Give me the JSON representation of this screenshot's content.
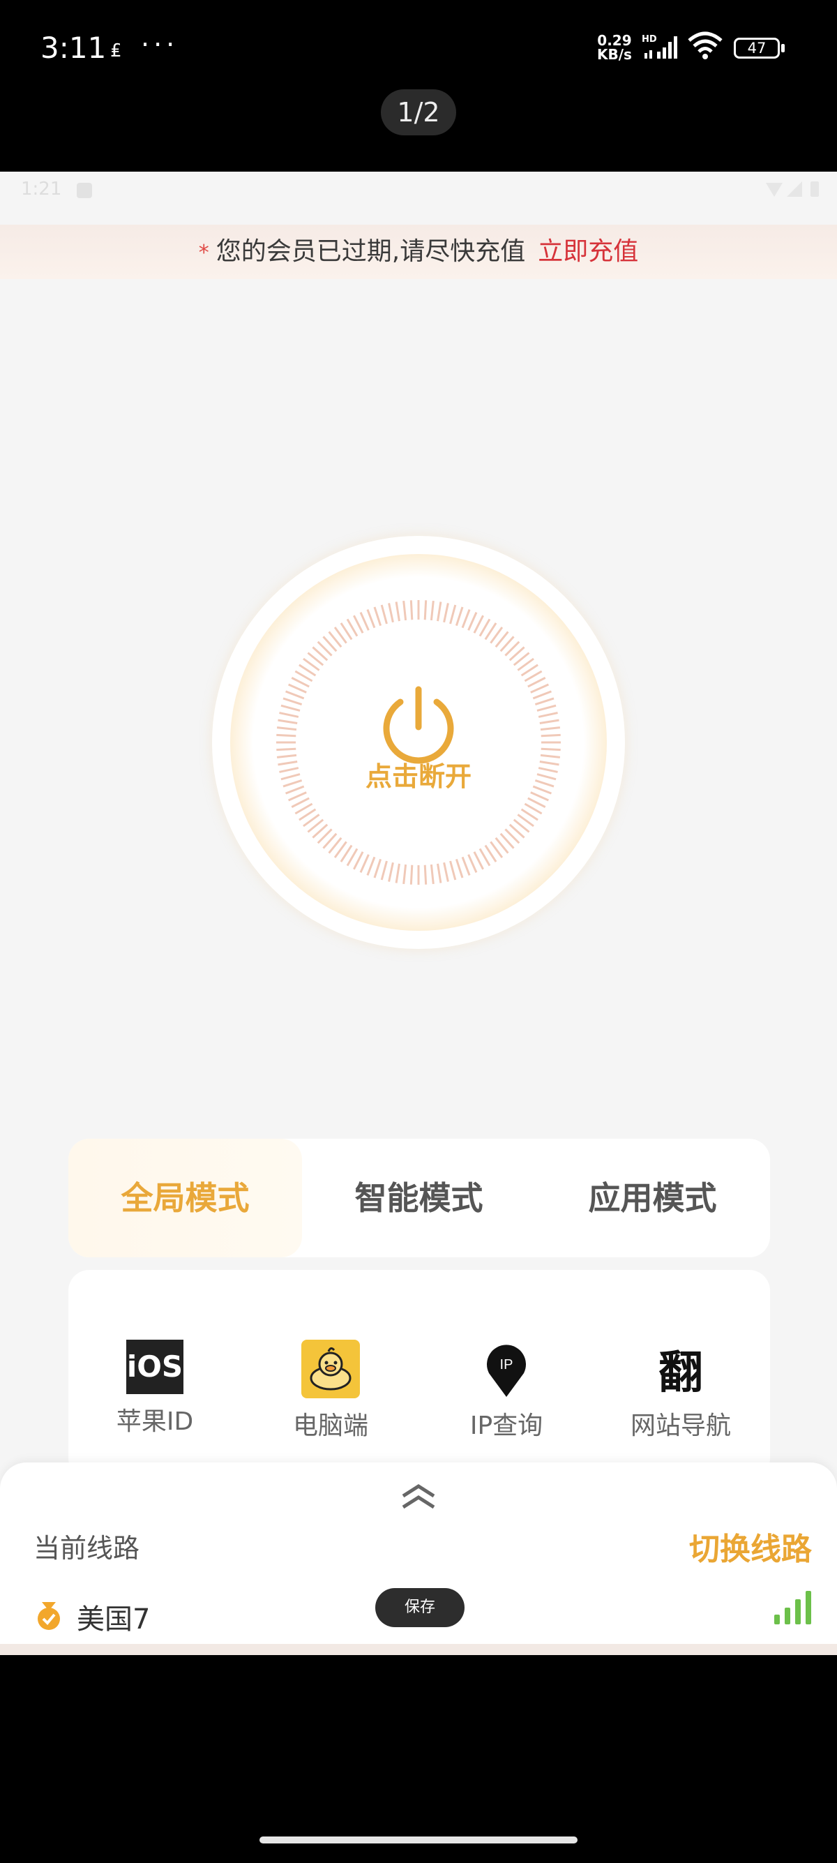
{
  "outer_status": {
    "time": "3:11",
    "speed_value": "0.29",
    "speed_unit": "KB/s",
    "hd_label": "HD",
    "battery": "47"
  },
  "page_counter": "1/2",
  "inner_status": {
    "time": "1:21"
  },
  "banner": {
    "prefix": "*",
    "message": "您的会员已过期,请尽快充值",
    "action": "立即充值"
  },
  "power": {
    "label": "点击断开"
  },
  "modes": [
    {
      "label": "全局模式",
      "active": true
    },
    {
      "label": "智能模式",
      "active": false
    },
    {
      "label": "应用模式",
      "active": false
    }
  ],
  "tools": [
    {
      "label": "苹果ID",
      "icon": "ios-icon",
      "icon_text": "iOS"
    },
    {
      "label": "电脑端",
      "icon": "duck-icon"
    },
    {
      "label": "IP查询",
      "icon": "ip-pin-icon",
      "icon_text": "IP"
    },
    {
      "label": "网站导航",
      "icon": "fan-icon",
      "icon_text": "翻"
    }
  ],
  "line": {
    "label": "当前线路",
    "switch": "切换线路",
    "node": "美国7",
    "toast": "保存"
  },
  "colors": {
    "accent": "#E9A83A",
    "alert": "#D6333A",
    "signal": "#6CC04A"
  }
}
